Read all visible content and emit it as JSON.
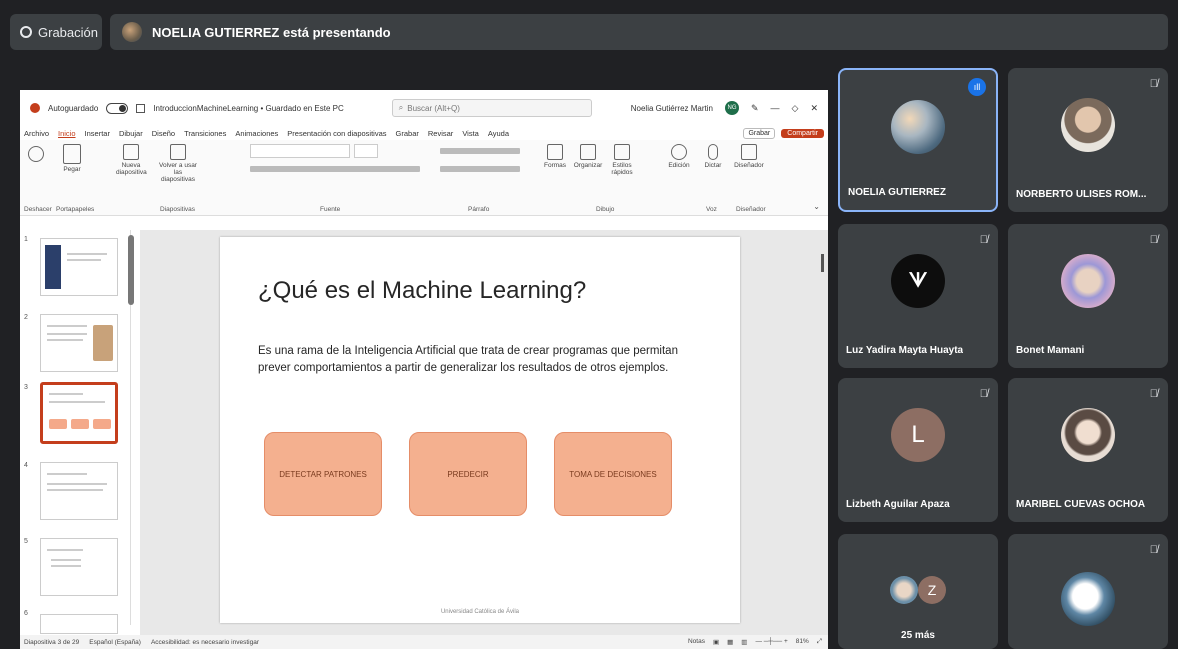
{
  "top_bar": {
    "recording_label": "Grabación",
    "presenter_banner": "NOELIA GUTIERREZ está presentando"
  },
  "powerpoint": {
    "autosave_label": "Autoguardado",
    "file_title": "IntroduccionMachineLearning • Guardado en Este PC",
    "search_placeholder": "Buscar (Alt+Q)",
    "user_name": "Noelia Gutiérrez Martin",
    "user_initials": "NG",
    "menu": [
      "Archivo",
      "Inicio",
      "Insertar",
      "Dibujar",
      "Diseño",
      "Transiciones",
      "Animaciones",
      "Presentación con diapositivas",
      "Grabar",
      "Revisar",
      "Vista",
      "Ayuda"
    ],
    "record_button": "Grabar",
    "share_button": "Compartir",
    "ribbon": {
      "paste": "Pegar",
      "new_slide": "Nueva diapositiva",
      "reuse_slides": "Volver a usar las diapositivas",
      "shapes": "Formas",
      "arrange": "Organizar",
      "quick_styles": "Estilos rápidos",
      "editing": "Edición",
      "dictate": "Dictar",
      "designer": "Diseñador",
      "groups": [
        "Deshacer",
        "Portapapeles",
        "Diapositivas",
        "Fuente",
        "Párrafo",
        "Dibujo",
        "Voz",
        "Diseñador"
      ]
    },
    "thumbnail_numbers": [
      "1",
      "2",
      "3",
      "4",
      "5",
      "6"
    ],
    "slide": {
      "title": "¿Qué es el Machine Learning?",
      "body": "Es una rama de la Inteligencia Artificial que trata de crear programas que permitan prever comportamientos a partir de generalizar los resultados de otros ejemplos.",
      "boxes": [
        "DETECTAR PATRONES",
        "PREDECIR",
        "TOMA DE DECISIONES"
      ],
      "footer": "Universidad Católica de Ávila"
    },
    "status": {
      "slide_counter": "Diapositiva 3 de 29",
      "language": "Español (España)",
      "accessibility": "Accesibilidad: es necesario investigar",
      "notes": "Notas",
      "zoom": "81%"
    }
  },
  "participants": [
    {
      "name": "NOELIA GUTIERREZ",
      "state": "speaking",
      "avatar_color": "#8a9aa6"
    },
    {
      "name": "NORBERTO ULISES ROM...",
      "state": "muted",
      "avatar_color": "#b8a99a"
    },
    {
      "name": "Luz Yadira Mayta Huayta",
      "state": "muted",
      "avatar_color": "#111111"
    },
    {
      "name": "Bonet Mamani",
      "state": "muted",
      "avatar_color": "#a7a6d9"
    },
    {
      "name": "Lizbeth Aguilar Apaza",
      "state": "muted",
      "avatar_letter": "L",
      "avatar_color": "#8d6e63"
    },
    {
      "name": "MARIBEL CUEVAS OCHOA",
      "state": "muted",
      "avatar_color": "#d8c6b3"
    },
    {
      "more_count": "25 más",
      "more_letter": "Z",
      "more_color": "#8d6e63"
    },
    {
      "name": "",
      "state": "muted",
      "avatar_color": "#6f8fa8"
    }
  ]
}
